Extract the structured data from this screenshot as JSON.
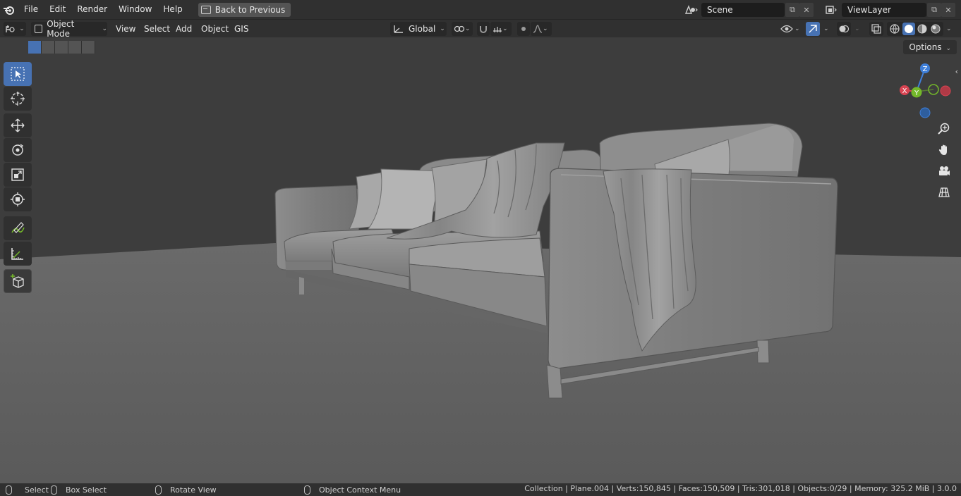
{
  "menu": {
    "items": [
      "File",
      "Edit",
      "Render",
      "Window",
      "Help"
    ],
    "back_button": "Back to Previous"
  },
  "scene_selector": {
    "value": "Scene"
  },
  "viewlayer_selector": {
    "value": "ViewLayer"
  },
  "header": {
    "mode": "Object Mode",
    "menus": [
      "View",
      "Select",
      "Add",
      "Object",
      "GIS"
    ],
    "transform_orientation": "Global",
    "options_label": "Options"
  },
  "gizmo": {
    "z": "Z",
    "y": "Y",
    "x": "X"
  },
  "status": {
    "select": "Select",
    "box_select": "Box Select",
    "rotate_view": "Rotate View",
    "context_menu": "Object Context Menu",
    "stats": "Collection | Plane.004 | Verts:150,845 | Faces:150,509 | Tris:301,018 | Objects:0/29 | Memory: 325.2 MiB | 3.0.0"
  },
  "colors": {
    "accent": "#4772b3",
    "axis_x": "#d94452",
    "axis_y": "#74b82a",
    "axis_z": "#3f7fd9"
  },
  "icons": [
    "blender-logo",
    "select-box-icon",
    "cursor-icon",
    "move-icon",
    "rotate-icon",
    "scale-icon",
    "transform-icon",
    "annotate-icon",
    "measure-icon",
    "add-cube-icon",
    "zoom-icon",
    "hand-icon",
    "camera-icon",
    "grid-icon"
  ]
}
